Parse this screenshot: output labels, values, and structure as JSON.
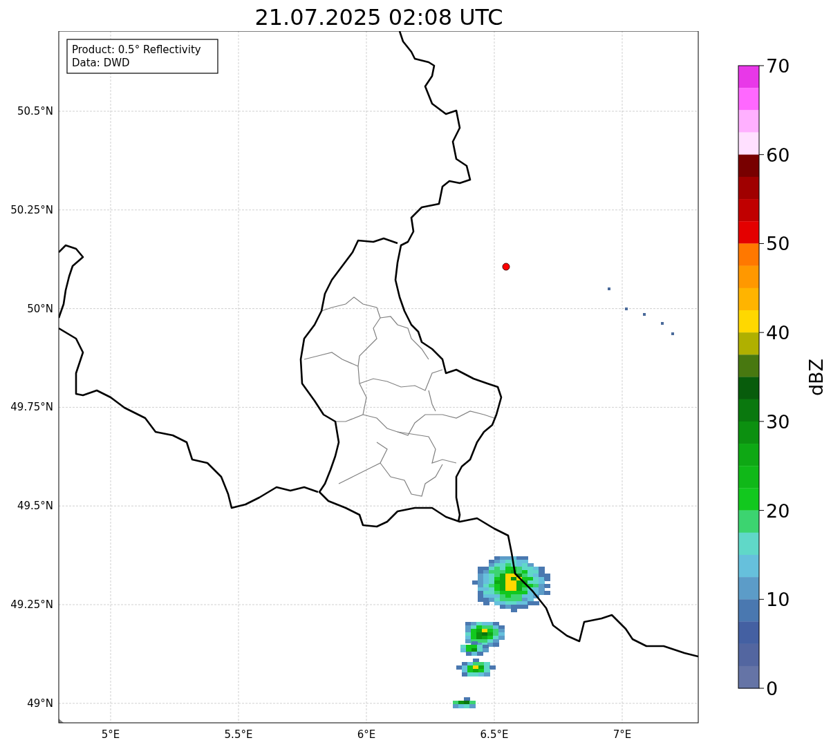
{
  "title": "21.07.2025 02:08 UTC",
  "info_box": {
    "lines": [
      "Product: 0.5° Reflectivity",
      "Data: DWD"
    ]
  },
  "map": {
    "lat_ticks": [
      "50.5°N",
      "50.25°N",
      "50°N",
      "49.75°N",
      "49.5°N",
      "49.25°N",
      "49°N"
    ],
    "lon_ticks": [
      "5°E",
      "5.5°E",
      "6°E",
      "6.5°E",
      "7°E"
    ]
  },
  "colorbar": {
    "label": "dBZ",
    "ticks": [
      "70",
      "60",
      "50",
      "40",
      "30",
      "20",
      "10",
      "0"
    ],
    "bins": [
      {
        "color": "#e838e8"
      },
      {
        "color": "#ff68ff"
      },
      {
        "color": "#ffb0ff"
      },
      {
        "color": "#ffe0ff"
      },
      {
        "color": "#780000"
      },
      {
        "color": "#a00000"
      },
      {
        "color": "#c00000"
      },
      {
        "color": "#e40000"
      },
      {
        "color": "#ff7800"
      },
      {
        "color": "#ff9800"
      },
      {
        "color": "#ffb400"
      },
      {
        "color": "#ffd800"
      },
      {
        "color": "#b0b000"
      },
      {
        "color": "#487810"
      },
      {
        "color": "#085c0c"
      },
      {
        "color": "#0a780e"
      },
      {
        "color": "#0c9010"
      },
      {
        "color": "#0ea814"
      },
      {
        "color": "#10b818"
      },
      {
        "color": "#12c81e"
      },
      {
        "color": "#3cd470"
      },
      {
        "color": "#60d8c8"
      },
      {
        "color": "#66c0dc"
      },
      {
        "color": "#5c9cc8"
      },
      {
        "color": "#4a78b0"
      },
      {
        "color": "#4460a2"
      },
      {
        "color": "#5366a0"
      },
      {
        "color": "#6574a6"
      }
    ]
  }
}
